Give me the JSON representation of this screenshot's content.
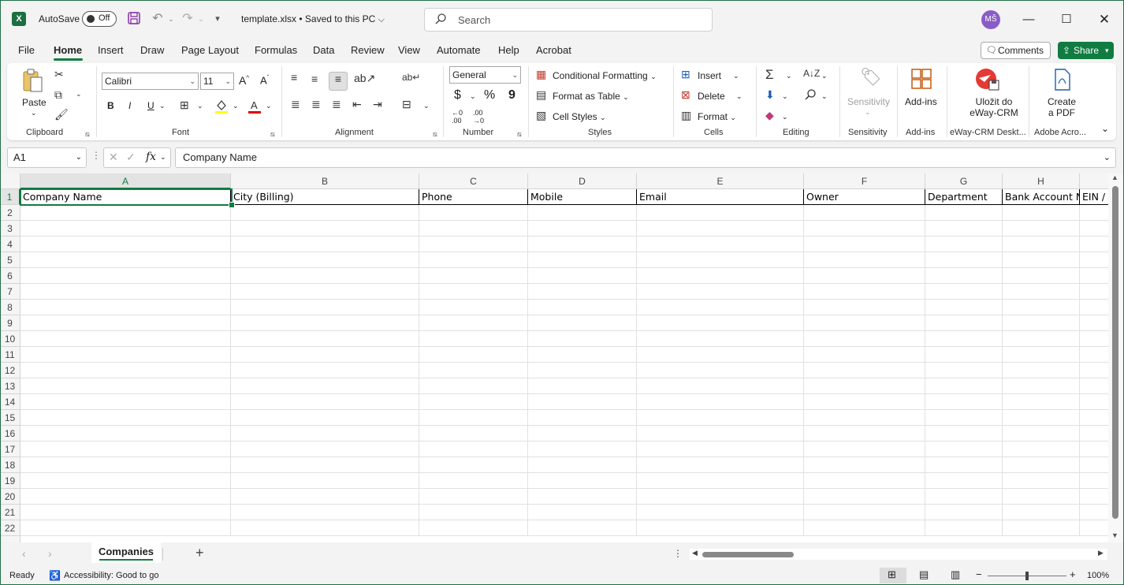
{
  "titlebar": {
    "app_logo": "X",
    "autosave_label": "AutoSave",
    "autosave_state": "Off",
    "document_title": "template.xlsx • Saved to this PC",
    "title_chevron": "⌵",
    "search_placeholder": "Search",
    "user_initials": "MŠ",
    "icons": [
      "excel-icon",
      "save-icon",
      "undo-icon",
      "redo-icon",
      "customize-quick-access-icon",
      "search-icon",
      "minimize-icon",
      "maximize-icon",
      "close-icon"
    ]
  },
  "tabs": [
    "File",
    "Home",
    "Insert",
    "Draw",
    "Page Layout",
    "Formulas",
    "Data",
    "Review",
    "View",
    "Automate",
    "Help",
    "Acrobat"
  ],
  "active_tab": "Home",
  "comments_label": "Comments",
  "share_label": "Share",
  "ribbon": {
    "clipboard": {
      "paste": "Paste",
      "label": "Clipboard"
    },
    "font": {
      "family": "Calibri",
      "size": "11",
      "bold": "B",
      "italic": "I",
      "underline": "U",
      "label": "Font"
    },
    "alignment": {
      "label": "Alignment"
    },
    "number": {
      "format": "General",
      "label": "Number"
    },
    "styles": {
      "conditional": "Conditional Formatting",
      "format_table": "Format as Table",
      "cell_styles": "Cell Styles",
      "label": "Styles"
    },
    "cells": {
      "insert": "Insert",
      "delete": "Delete",
      "format": "Format",
      "label": "Cells"
    },
    "editing": {
      "label": "Editing"
    },
    "sensitivity": {
      "button": "Sensitivity",
      "label": "Sensitivity"
    },
    "addins": {
      "button": "Add-ins",
      "label": "Add-ins"
    },
    "eway": {
      "button_line1": "Uložit do",
      "button_line2": "eWay-CRM",
      "label": "eWay-CRM Deskt..."
    },
    "acrobat": {
      "button_line1": "Create",
      "button_line2": "a PDF",
      "label": "Adobe Acro..."
    },
    "accent_color": "#107c41"
  },
  "formula_bar": {
    "name_box": "A1",
    "fx": "fx",
    "content": "Company Name"
  },
  "grid": {
    "columns": [
      "A",
      "B",
      "C",
      "D",
      "E",
      "F",
      "G",
      "H"
    ],
    "header_row": [
      "Company Name",
      "City (Billing)",
      "Phone",
      "Mobile",
      "Email",
      "Owner",
      "Department",
      "Bank Account N",
      "EIN /"
    ],
    "rows": [
      "1",
      "2",
      "3",
      "4",
      "5",
      "6",
      "7",
      "8",
      "9",
      "10",
      "11",
      "12",
      "13",
      "14",
      "15",
      "16",
      "17",
      "18",
      "19",
      "20",
      "21",
      "22"
    ],
    "active_cell": "A1"
  },
  "sheets": [
    "Companies"
  ],
  "statusbar": {
    "ready": "Ready",
    "accessibility": "Accessibility: Good to go",
    "zoom": "100%"
  }
}
